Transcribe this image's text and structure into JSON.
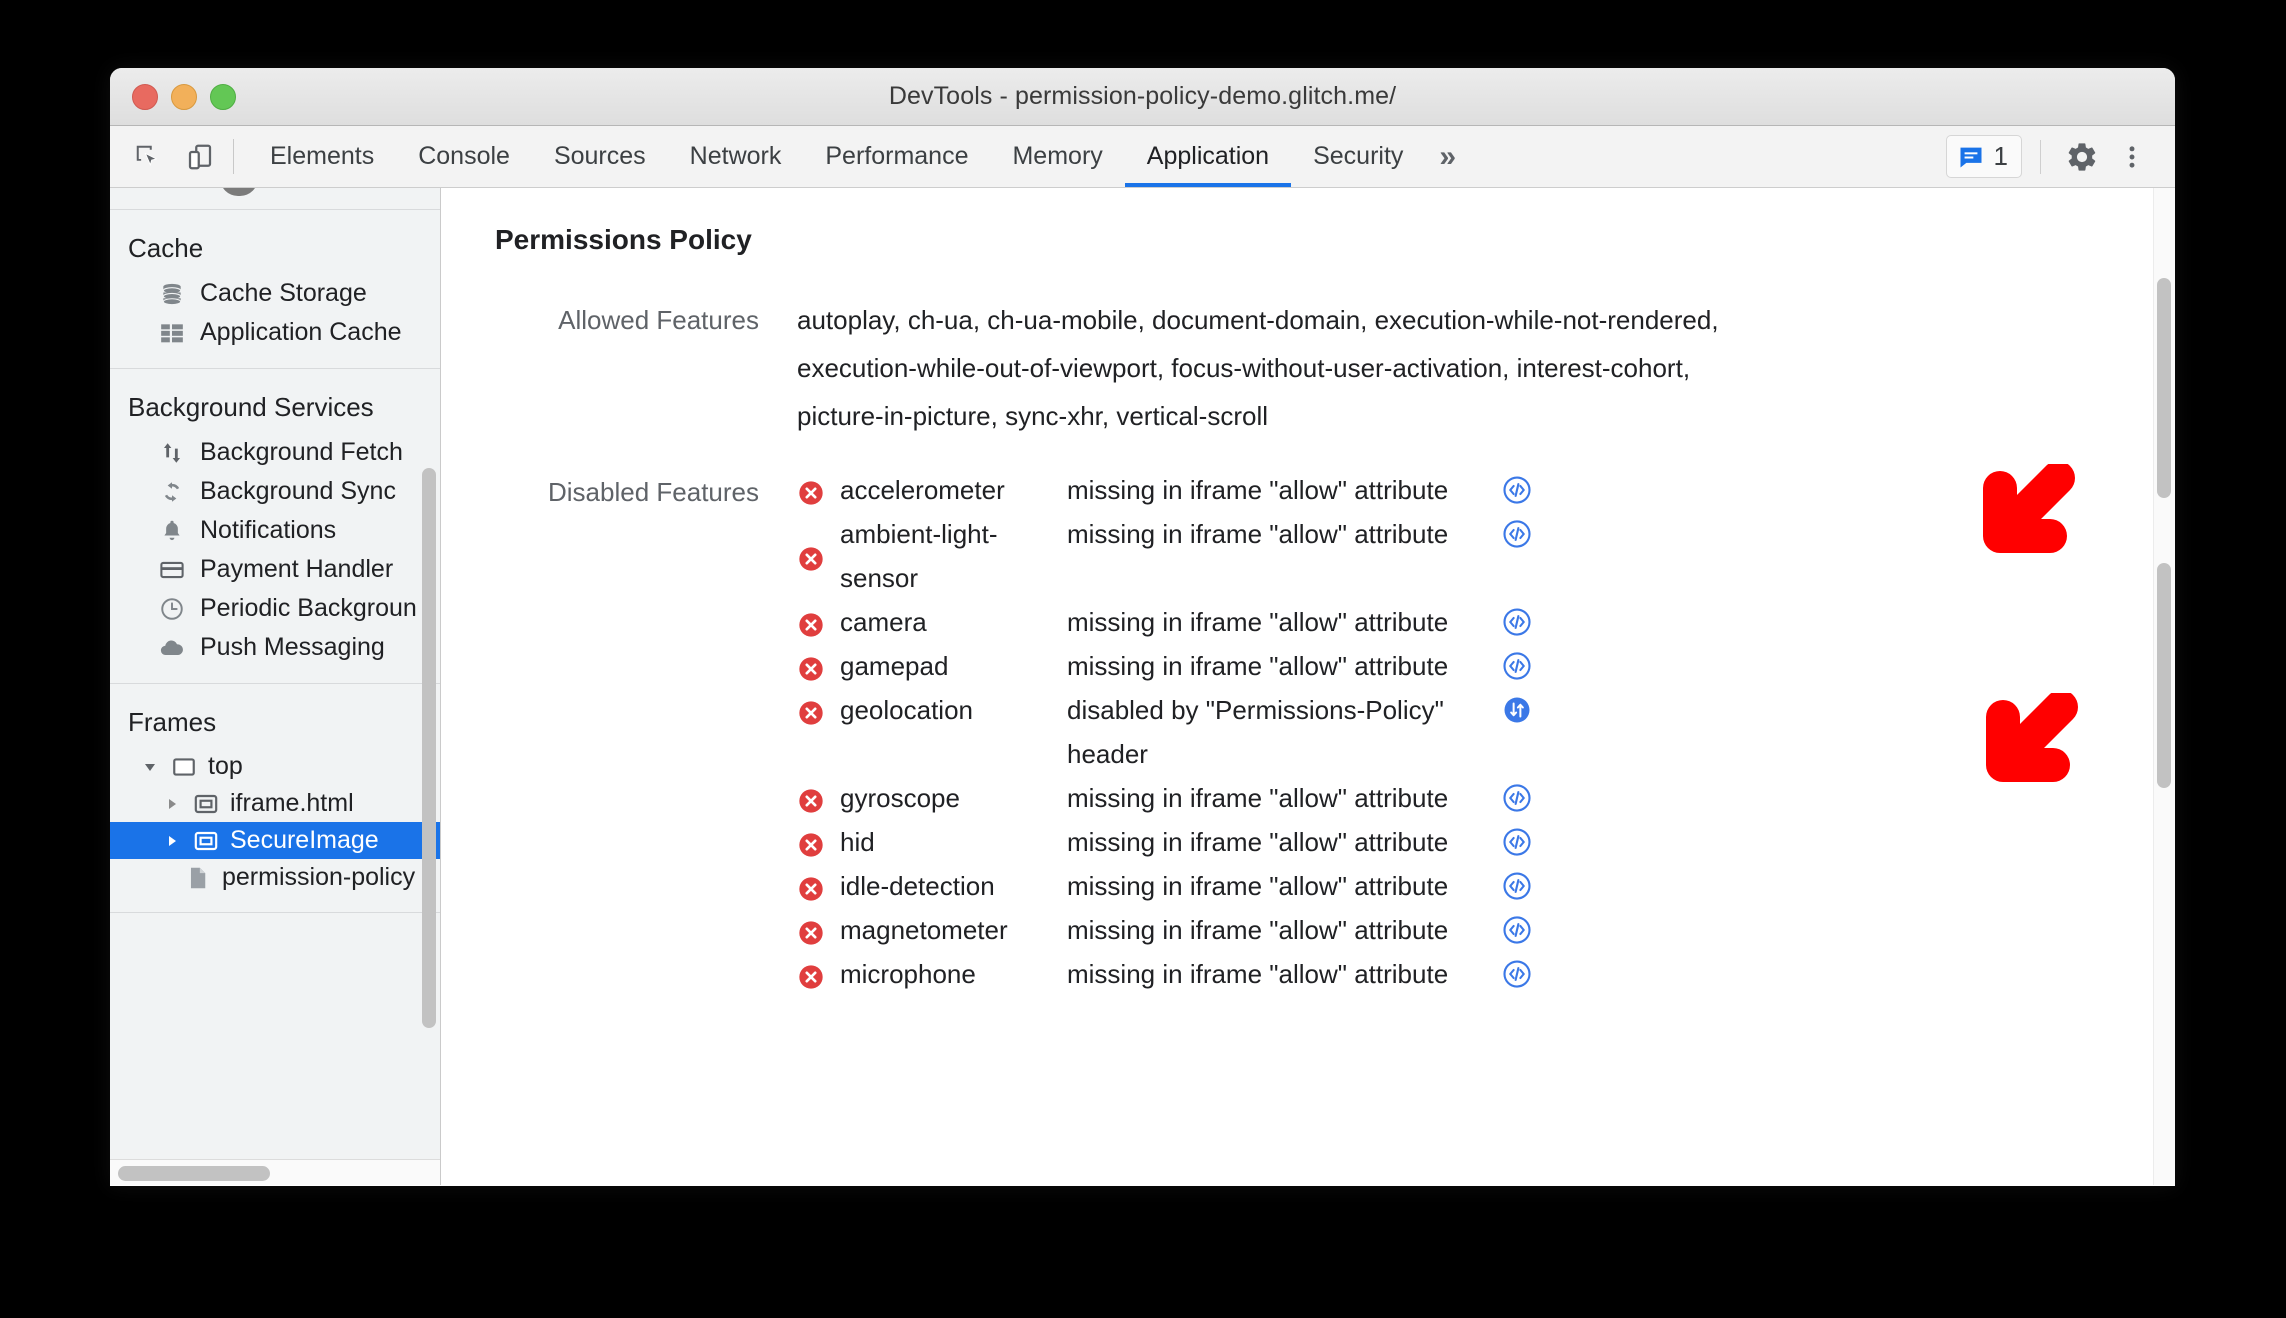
{
  "window": {
    "title": "DevTools - permission-policy-demo.glitch.me/",
    "traffic_lights": [
      "close-red",
      "minimize-yellow",
      "maximize-green"
    ]
  },
  "toolbar": {
    "inspect_icon": "inspect-element-icon",
    "device_icon": "device-toolbar-icon",
    "tabs": [
      {
        "label": "Elements",
        "active": false
      },
      {
        "label": "Console",
        "active": false
      },
      {
        "label": "Sources",
        "active": false
      },
      {
        "label": "Network",
        "active": false
      },
      {
        "label": "Performance",
        "active": false
      },
      {
        "label": "Memory",
        "active": false
      },
      {
        "label": "Application",
        "active": true
      },
      {
        "label": "Security",
        "active": false
      }
    ],
    "more_tabs_label": "»",
    "message_count": "1",
    "message_icon": "message-bubble-icon",
    "settings_icon": "gear-icon",
    "menu_icon": "kebab-menu-icon",
    "accent_color": "#1a73e8"
  },
  "sidebar": {
    "sections": [
      {
        "title": "Cache",
        "items": [
          {
            "label": "Cache Storage",
            "icon": "database-icon"
          },
          {
            "label": "Application Cache",
            "icon": "grid-icon"
          }
        ]
      },
      {
        "title": "Background Services",
        "items": [
          {
            "label": "Background Fetch",
            "icon": "up-down-arrows-icon"
          },
          {
            "label": "Background Sync",
            "icon": "sync-icon"
          },
          {
            "label": "Notifications",
            "icon": "bell-icon"
          },
          {
            "label": "Payment Handler",
            "icon": "credit-card-icon"
          },
          {
            "label": "Periodic Backgroun",
            "icon": "clock-icon"
          },
          {
            "label": "Push Messaging",
            "icon": "cloud-icon"
          }
        ]
      }
    ],
    "frames": {
      "title": "Frames",
      "tree": [
        {
          "label": "top",
          "depth": 1,
          "twisty": "expanded",
          "icon": "frame-icon",
          "selected": false
        },
        {
          "label": "iframe.html",
          "depth": 2,
          "twisty": "collapsed",
          "icon": "iframe-icon",
          "selected": false
        },
        {
          "label": "SecureImage",
          "depth": 2,
          "twisty": "collapsed",
          "icon": "iframe-icon",
          "selected": true
        },
        {
          "label": "permission-policy",
          "depth": 3,
          "twisty": "none",
          "icon": "document-icon",
          "selected": false
        }
      ]
    },
    "selected_color": "#1a73e8"
  },
  "main": {
    "panel_title": "Permissions Policy",
    "allowed": {
      "label": "Allowed Features",
      "lines": [
        "autoplay, ch-ua, ch-ua-mobile, document-domain, execution-while-not-rendered,",
        "execution-while-out-of-viewport, focus-without-user-activation, interest-cohort,",
        "picture-in-picture, sync-xhr, vertical-scroll"
      ]
    },
    "disabled": {
      "label": "Disabled Features",
      "rows": [
        {
          "name": "accelerometer",
          "reason": "missing in iframe \"allow\" attribute",
          "link_icon": "source-code-icon"
        },
        {
          "name": "ambient-light-sensor",
          "reason": "missing in iframe \"allow\" attribute",
          "link_icon": "source-code-icon"
        },
        {
          "name": "camera",
          "reason": "missing in iframe \"allow\" attribute",
          "link_icon": "source-code-icon"
        },
        {
          "name": "gamepad",
          "reason": "missing in iframe \"allow\" attribute",
          "link_icon": "source-code-icon"
        },
        {
          "name": "geolocation",
          "reason": "disabled by \"Permissions-Policy\" header",
          "link_icon": "network-request-icon"
        },
        {
          "name": "gyroscope",
          "reason": "missing in iframe \"allow\" attribute",
          "link_icon": "source-code-icon"
        },
        {
          "name": "hid",
          "reason": "missing in iframe \"allow\" attribute",
          "link_icon": "source-code-icon"
        },
        {
          "name": "idle-detection",
          "reason": "missing in iframe \"allow\" attribute",
          "link_icon": "source-code-icon"
        },
        {
          "name": "magnetometer",
          "reason": "missing in iframe \"allow\" attribute",
          "link_icon": "source-code-icon"
        },
        {
          "name": "microphone",
          "reason": "missing in iframe \"allow\" attribute",
          "link_icon": "source-code-icon"
        }
      ],
      "error_icon": "error-circle-x-icon",
      "error_color": "#e03e3e",
      "link_color": "#3b78e7"
    }
  },
  "annotations": {
    "arrows": [
      {
        "name": "red-arrow-source-link",
        "color": "#ff0000"
      },
      {
        "name": "red-arrow-network-link",
        "color": "#ff0000"
      }
    ]
  }
}
